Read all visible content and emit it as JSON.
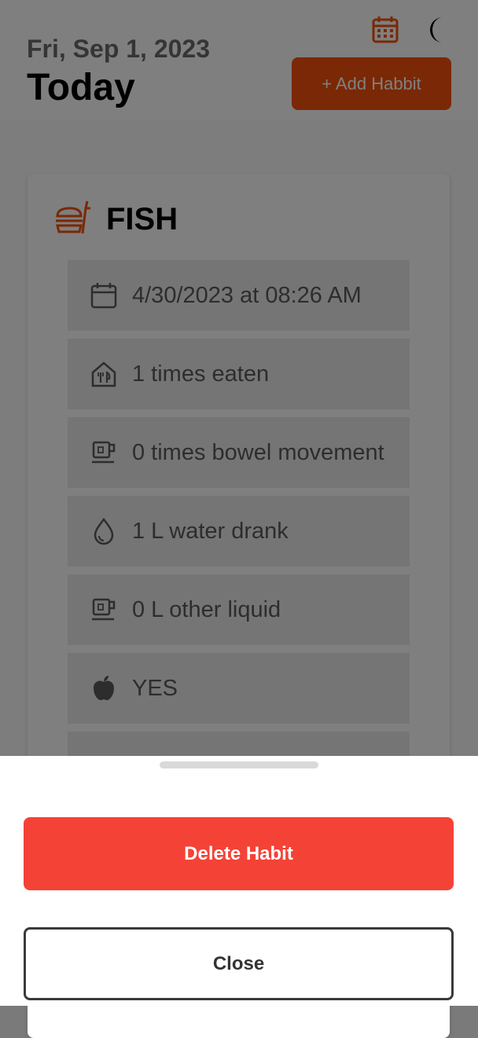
{
  "header": {
    "date": "Fri, Sep 1, 2023",
    "title": "Today",
    "add_button": "+ Add Habbit",
    "icons": {
      "calendar": "calendar-icon",
      "theme": "moon-icon"
    }
  },
  "habit_card": {
    "title": "FISH",
    "icon": "fast-food-icon",
    "rows": [
      {
        "icon": "calendar-icon",
        "text": "4/30/2023 at 08:26 AM"
      },
      {
        "icon": "restaurant-icon",
        "text": "1 times eaten"
      },
      {
        "icon": "cup-icon",
        "text": "0 times bowel movement"
      },
      {
        "icon": "water-drop-icon",
        "text": "1 L water drank"
      },
      {
        "icon": "cup-icon",
        "text": "0 L other liquid"
      },
      {
        "icon": "apple-icon",
        "text": "YES"
      }
    ]
  },
  "sheet": {
    "delete_label": "Delete Habit",
    "close_label": "Close"
  },
  "colors": {
    "accent": "#f4510b",
    "danger": "#f44336"
  }
}
